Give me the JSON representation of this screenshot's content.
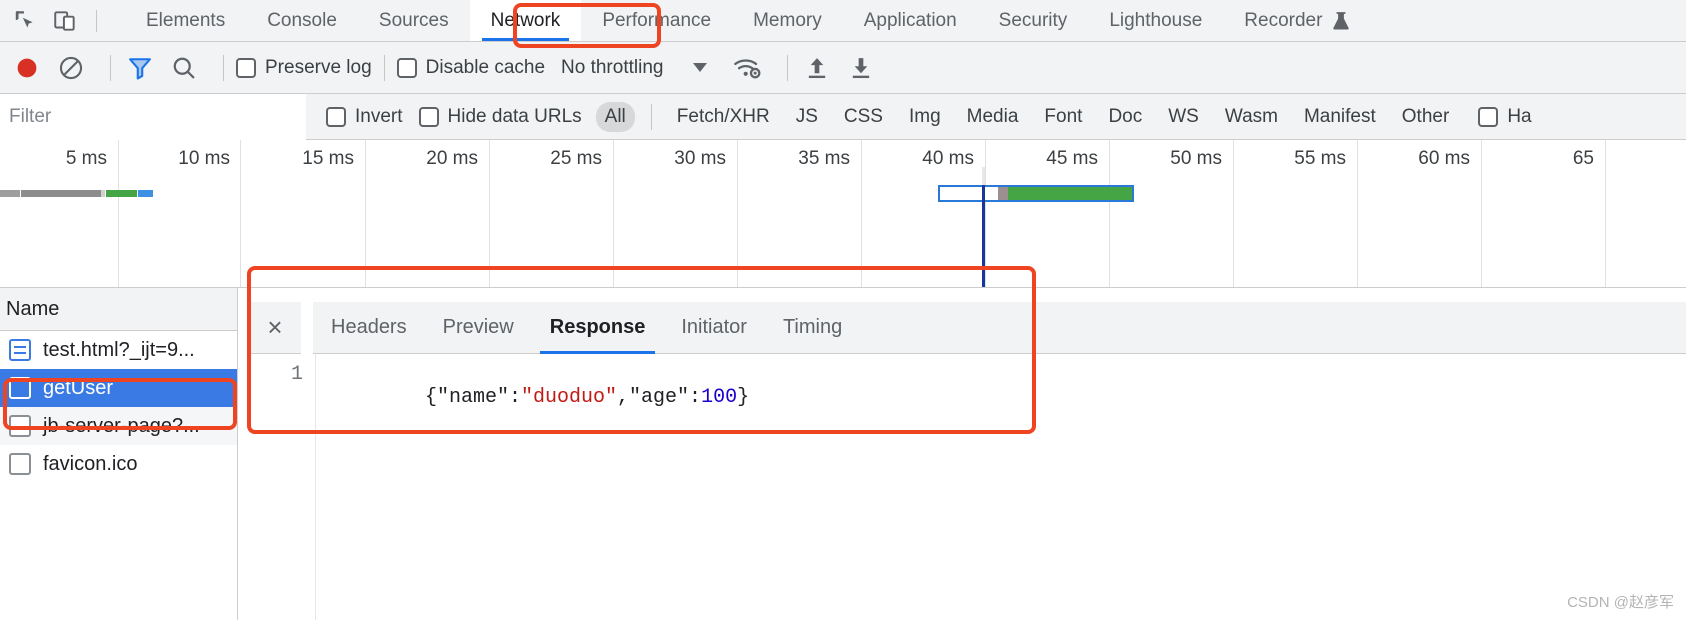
{
  "tabbar": {
    "inspect_icon": "inspect-element-icon",
    "device_icon": "device-toolbar-icon",
    "tabs": [
      {
        "label": "Elements",
        "active": false
      },
      {
        "label": "Console",
        "active": false
      },
      {
        "label": "Sources",
        "active": false
      },
      {
        "label": "Network",
        "active": true
      },
      {
        "label": "Performance",
        "active": false
      },
      {
        "label": "Memory",
        "active": false
      },
      {
        "label": "Application",
        "active": false
      },
      {
        "label": "Security",
        "active": false
      },
      {
        "label": "Lighthouse",
        "active": false
      },
      {
        "label": "Recorder",
        "active": false,
        "icon": "flask-icon"
      }
    ]
  },
  "toolbar": {
    "record_icon": "record-button-icon",
    "clear_icon": "clear-icon",
    "filter_icon": "filter-funnel-icon",
    "search_icon": "search-icon",
    "preserve_log_label": "Preserve log",
    "preserve_log_checked": false,
    "disable_cache_label": "Disable cache",
    "disable_cache_checked": false,
    "throttling_value": "No throttling",
    "network_conditions_icon": "wifi-gear-icon",
    "import_icon": "import-har-icon",
    "export_icon": "export-har-icon"
  },
  "filterbar": {
    "filter_placeholder": "Filter",
    "filter_value": "",
    "invert_label": "Invert",
    "invert_checked": false,
    "hide_data_urls_label": "Hide data URLs",
    "hide_data_urls_checked": false,
    "types": [
      {
        "label": "All",
        "active": true
      },
      {
        "label": "Fetch/XHR",
        "active": false
      },
      {
        "label": "JS",
        "active": false
      },
      {
        "label": "CSS",
        "active": false
      },
      {
        "label": "Img",
        "active": false
      },
      {
        "label": "Media",
        "active": false
      },
      {
        "label": "Font",
        "active": false
      },
      {
        "label": "Doc",
        "active": false
      },
      {
        "label": "WS",
        "active": false
      },
      {
        "label": "Wasm",
        "active": false
      },
      {
        "label": "Manifest",
        "active": false
      },
      {
        "label": "Other",
        "active": false
      }
    ],
    "blocked_cookies_label": "Ha",
    "blocked_cookies_checked": false
  },
  "overview": {
    "ticks": [
      "5 ms",
      "10 ms",
      "15 ms",
      "20 ms",
      "25 ms",
      "30 ms",
      "35 ms",
      "40 ms",
      "45 ms",
      "50 ms",
      "55 ms",
      "60 ms",
      "65 "
    ],
    "colors": {
      "gray": "#9e9e9e",
      "green": "#45a545",
      "blue": "#3e90e5",
      "box_border": "#2979d8",
      "event_line": "#17379c"
    }
  },
  "request_list": {
    "column_header": "Name",
    "rows": [
      {
        "name": "test.html?_ijt=9...",
        "icon": "document-icon",
        "selected": false
      },
      {
        "name": "getUser",
        "icon": "xhr-icon",
        "selected": true
      },
      {
        "name": "jb-server-page?...",
        "icon": "xhr-icon",
        "selected": false
      },
      {
        "name": "favicon.ico",
        "icon": "image-icon",
        "selected": false
      }
    ]
  },
  "detail_panel": {
    "close_label": "×",
    "tabs": [
      {
        "label": "Headers",
        "active": false
      },
      {
        "label": "Preview",
        "active": false
      },
      {
        "label": "Response",
        "active": true
      },
      {
        "label": "Initiator",
        "active": false
      },
      {
        "label": "Timing",
        "active": false
      }
    ],
    "line_number": "1",
    "response_parts": [
      {
        "text": "{\"name\":",
        "kind": "plain"
      },
      {
        "text": "\"duoduo\"",
        "kind": "string"
      },
      {
        "text": ",\"age\":",
        "kind": "plain"
      },
      {
        "text": "100",
        "kind": "number"
      },
      {
        "text": "}",
        "kind": "plain"
      }
    ],
    "response_raw": "{\"name\":\"duoduo\",\"age\":100}"
  },
  "annotations": {
    "color": "#ef4422",
    "boxes": [
      "network-tab",
      "getuser-row",
      "response-panel"
    ]
  },
  "watermark": "CSDN @赵彦军"
}
